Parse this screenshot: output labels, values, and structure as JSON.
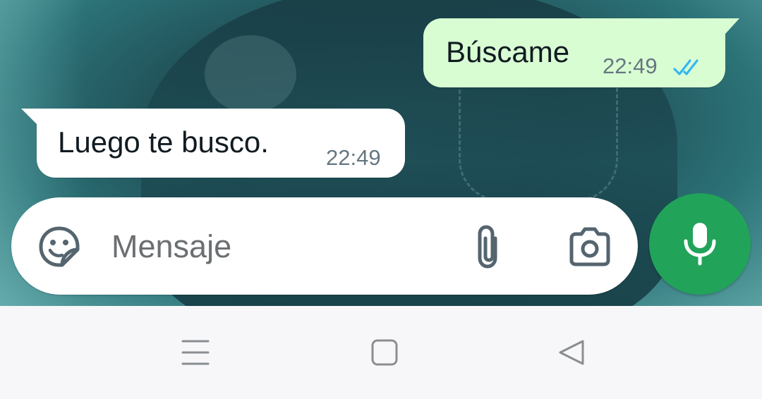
{
  "colors": {
    "outgoing_bubble": "#d9fdd3",
    "incoming_bubble": "#ffffff",
    "read_ticks": "#34b7f1",
    "mic_button": "#21a35a",
    "navbar": "#f7f7f9"
  },
  "messages": [
    {
      "direction": "outgoing",
      "text": "Búscame",
      "time": "22:49",
      "status_icon": "double-check-read-icon"
    },
    {
      "direction": "incoming",
      "text": "Luego te busco.",
      "time": "22:49"
    }
  ],
  "composer": {
    "placeholder": "Mensaje",
    "value": "",
    "icons": [
      "sticker-emoji-icon",
      "paperclip-icon",
      "camera-icon",
      "microphone-icon"
    ]
  },
  "navbar": {
    "icons": [
      "menu-icon",
      "home-square-icon",
      "back-triangle-icon"
    ]
  }
}
